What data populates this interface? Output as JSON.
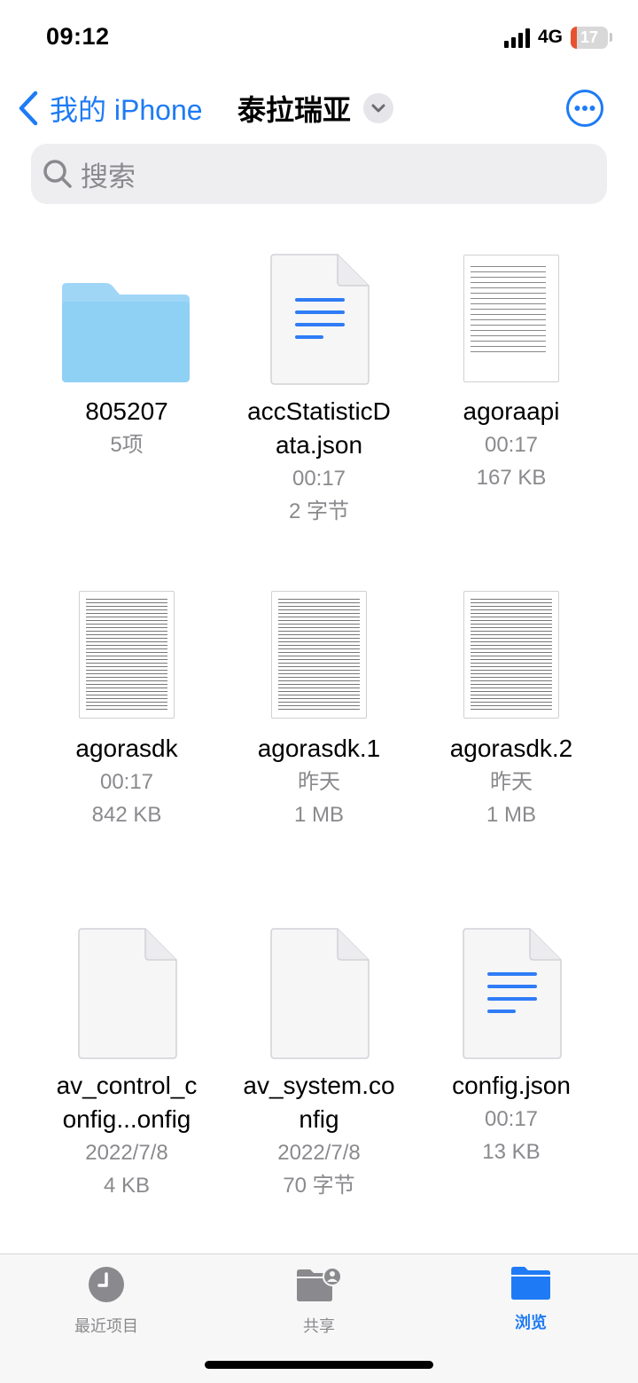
{
  "status": {
    "time": "09:12",
    "network": "4G",
    "battery": "17",
    "battery_level": 0.17
  },
  "nav": {
    "back_label": "我的 iPhone",
    "title": "泰拉瑞亚"
  },
  "search": {
    "placeholder": "搜索"
  },
  "items": [
    {
      "name": "805207",
      "meta1": "5项",
      "meta2": "",
      "icon": "folder-icon"
    },
    {
      "name_line1": "accStatisticD",
      "name_line2": "ata.json",
      "meta1": "00:17",
      "meta2": "2 字节",
      "icon": "text-document-icon"
    },
    {
      "name": "agoraapi",
      "meta1": "00:17",
      "meta2": "167 KB",
      "icon": "log-file-thumbnail"
    },
    {
      "name": "agorasdk",
      "meta1": "00:17",
      "meta2": "842 KB",
      "icon": "log-file-thumbnail"
    },
    {
      "name": "agorasdk.1",
      "meta1": "昨天",
      "meta2": "1 MB",
      "icon": "log-file-thumbnail"
    },
    {
      "name": "agorasdk.2",
      "meta1": "昨天",
      "meta2": "1 MB",
      "icon": "log-file-thumbnail"
    },
    {
      "name_line1": "av_control_c",
      "name_line2": "onfig...onfig",
      "meta1": "2022/7/8",
      "meta2": "4 KB",
      "icon": "blank-document-icon"
    },
    {
      "name_line1": "av_system.co",
      "name_line2": "nfig",
      "meta1": "2022/7/8",
      "meta2": "70 字节",
      "icon": "blank-document-icon"
    },
    {
      "name": "config.json",
      "meta1": "00:17",
      "meta2": "13 KB",
      "icon": "text-document-icon"
    }
  ],
  "tabs": [
    {
      "label": "最近项目",
      "icon": "clock-icon"
    },
    {
      "label": "共享",
      "icon": "shared-folder-icon"
    },
    {
      "label": "浏览",
      "icon": "folder-icon",
      "active": true
    }
  ],
  "colors": {
    "accent": "#1e7bf5",
    "folder": "#8fd0f5",
    "secondary_text": "#8a8a8e"
  }
}
